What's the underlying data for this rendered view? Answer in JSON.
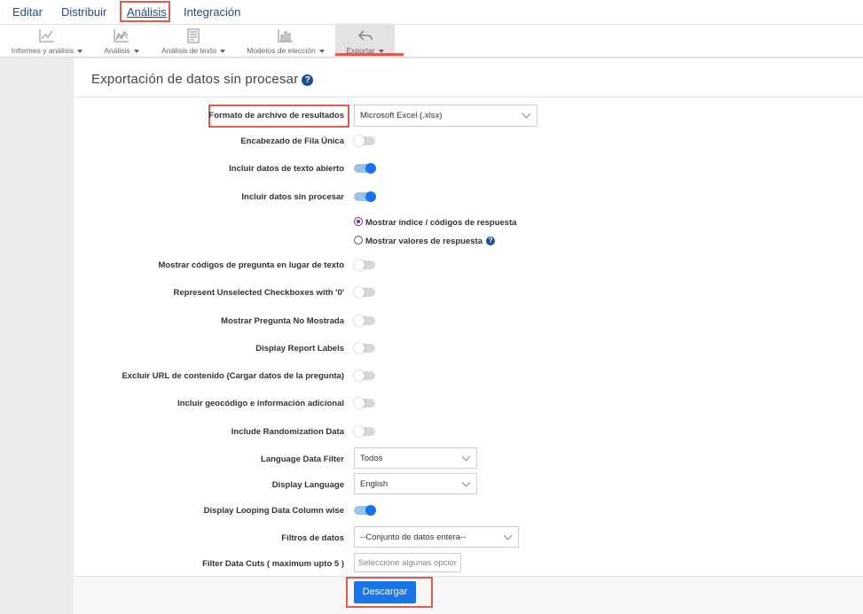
{
  "nav": {
    "items": [
      "Editar",
      "Distribuir",
      "Análisis",
      "Integración"
    ],
    "active": "Análisis"
  },
  "toolbar": {
    "items": [
      {
        "label": "Informes y análisis",
        "icon": "line-chart-icon"
      },
      {
        "label": "Análisis",
        "icon": "area-chart-icon"
      },
      {
        "label": "Análisis de texto",
        "icon": "document-icon"
      },
      {
        "label": "Modelos de elección",
        "icon": "bar-chart-icon"
      },
      {
        "label": "Exportar",
        "icon": "undo-arrow-icon"
      }
    ],
    "active": "Exportar"
  },
  "panel": {
    "title": "Exportación de datos sin procesar",
    "help": "?"
  },
  "form": {
    "file_format_label": "Formato de archivo de resultados",
    "file_format_value": "Microsoft Excel (.xlsx)",
    "single_row_header_label": "Encabezado de Fila Única",
    "single_row_header_on": false,
    "open_text_label": "Incluir datos de texto abierto",
    "open_text_on": true,
    "raw_data_label": "Incluir datos sin procesar",
    "raw_data_on": true,
    "radio_codes_label": "Mostrar índice / códigos de respuesta",
    "radio_codes_checked": true,
    "radio_values_label": "Mostrar valores de respuesta",
    "radio_values_checked": false,
    "question_codes_label": "Mostrar códigos de pregunta en lugar de texto",
    "question_codes_on": false,
    "unselected_checkboxes_label": "Represent Unselected Checkboxes with '0'",
    "unselected_checkboxes_on": false,
    "not_shown_label": "Mostrar Pregunta No Mostrada",
    "not_shown_on": false,
    "report_labels_label": "Display Report Labels",
    "report_labels_on": false,
    "exclude_url_label": "Excluir URL de contenido (Cargar datos de la pregunta)",
    "exclude_url_on": false,
    "geocode_label": "Incluir geocódigo e información adicional",
    "geocode_on": false,
    "randomization_label": "Include Randomization Data",
    "randomization_on": false,
    "language_filter_label": "Language Data Filter",
    "language_filter_value": "Todos",
    "display_language_label": "Display Language",
    "display_language_value": "English",
    "looping_label": "Display Looping Data Column wise",
    "looping_on": true,
    "data_filters_label": "Filtros de datos",
    "data_filters_value": "--Conjunto de datos entera--",
    "data_cuts_label": "Filter Data Cuts ( maximum upto 5 )",
    "data_cuts_placeholder": "Seleccione algunas opcior"
  },
  "actions": {
    "download_label": "Descargar"
  },
  "colors": {
    "accent": "#1a73e8",
    "nav_text": "#1f4d8c",
    "highlight": "#e05a4f",
    "radio_checked": "#8a2a86"
  }
}
